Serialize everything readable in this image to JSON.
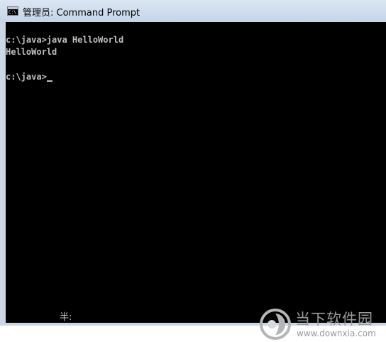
{
  "window": {
    "title": "管理员: Command Prompt",
    "icon": "cmd-icon",
    "icon_text": "C:\\"
  },
  "console": {
    "lines": [
      "c:\\java>java HelloWorld",
      "HelloWorld",
      "",
      "c:\\java>"
    ],
    "ime_status": "半:",
    "colors": {
      "background": "#000000",
      "text": "#c0c0c0"
    }
  },
  "watermark": {
    "logo": "downxia-logo",
    "title": "当下软件园",
    "url": "www.downxia.com"
  }
}
